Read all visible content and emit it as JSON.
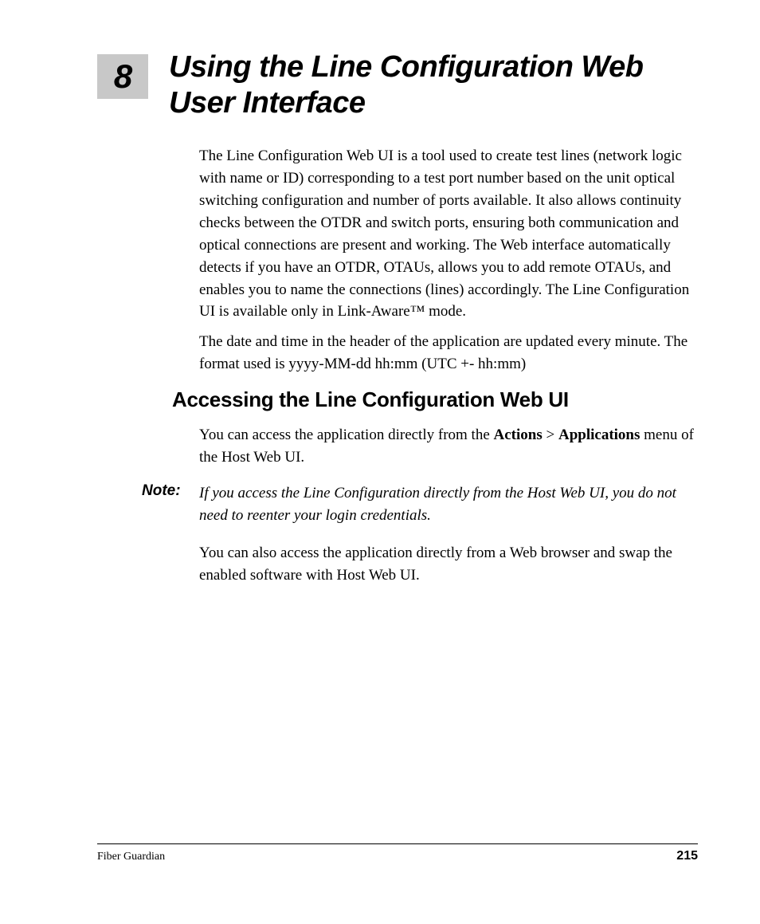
{
  "chapter": {
    "number": "8",
    "title": "Using the Line Configuration Web User Interface"
  },
  "paragraphs": {
    "intro1": "The Line Configuration Web UI is a tool used to create test lines (network logic with name or ID) corresponding to a test port number based on the unit optical switching configuration and number of ports available. It also allows continuity checks between the OTDR and switch ports, ensuring both communication and optical connections are present and working. The Web interface automatically detects if you have an OTDR, OTAUs, allows you to add remote OTAUs, and enables you to name the connections (lines) accordingly. The Line Configuration UI is available only in Link-Aware™ mode.",
    "intro2": "The date and time in the header of the application are updated every minute. The format used is yyyy-MM-dd hh:mm (UTC +- hh:mm)",
    "access1_pre": "You can access the application directly from the ",
    "access1_bold1": "Actions",
    "access1_mid": " > ",
    "access1_bold2": "Applications",
    "access1_post": " menu of the Host Web UI.",
    "note_label": "Note:",
    "note_body": "If you access the Line Configuration directly from the Host Web UI, you do not need to reenter your login credentials.",
    "access2": "You can also access the application directly from a Web browser and swap the enabled software with Host Web UI."
  },
  "headings": {
    "h2_access": "Accessing the Line Configuration Web UI"
  },
  "footer": {
    "left": "Fiber Guardian",
    "right": "215"
  }
}
